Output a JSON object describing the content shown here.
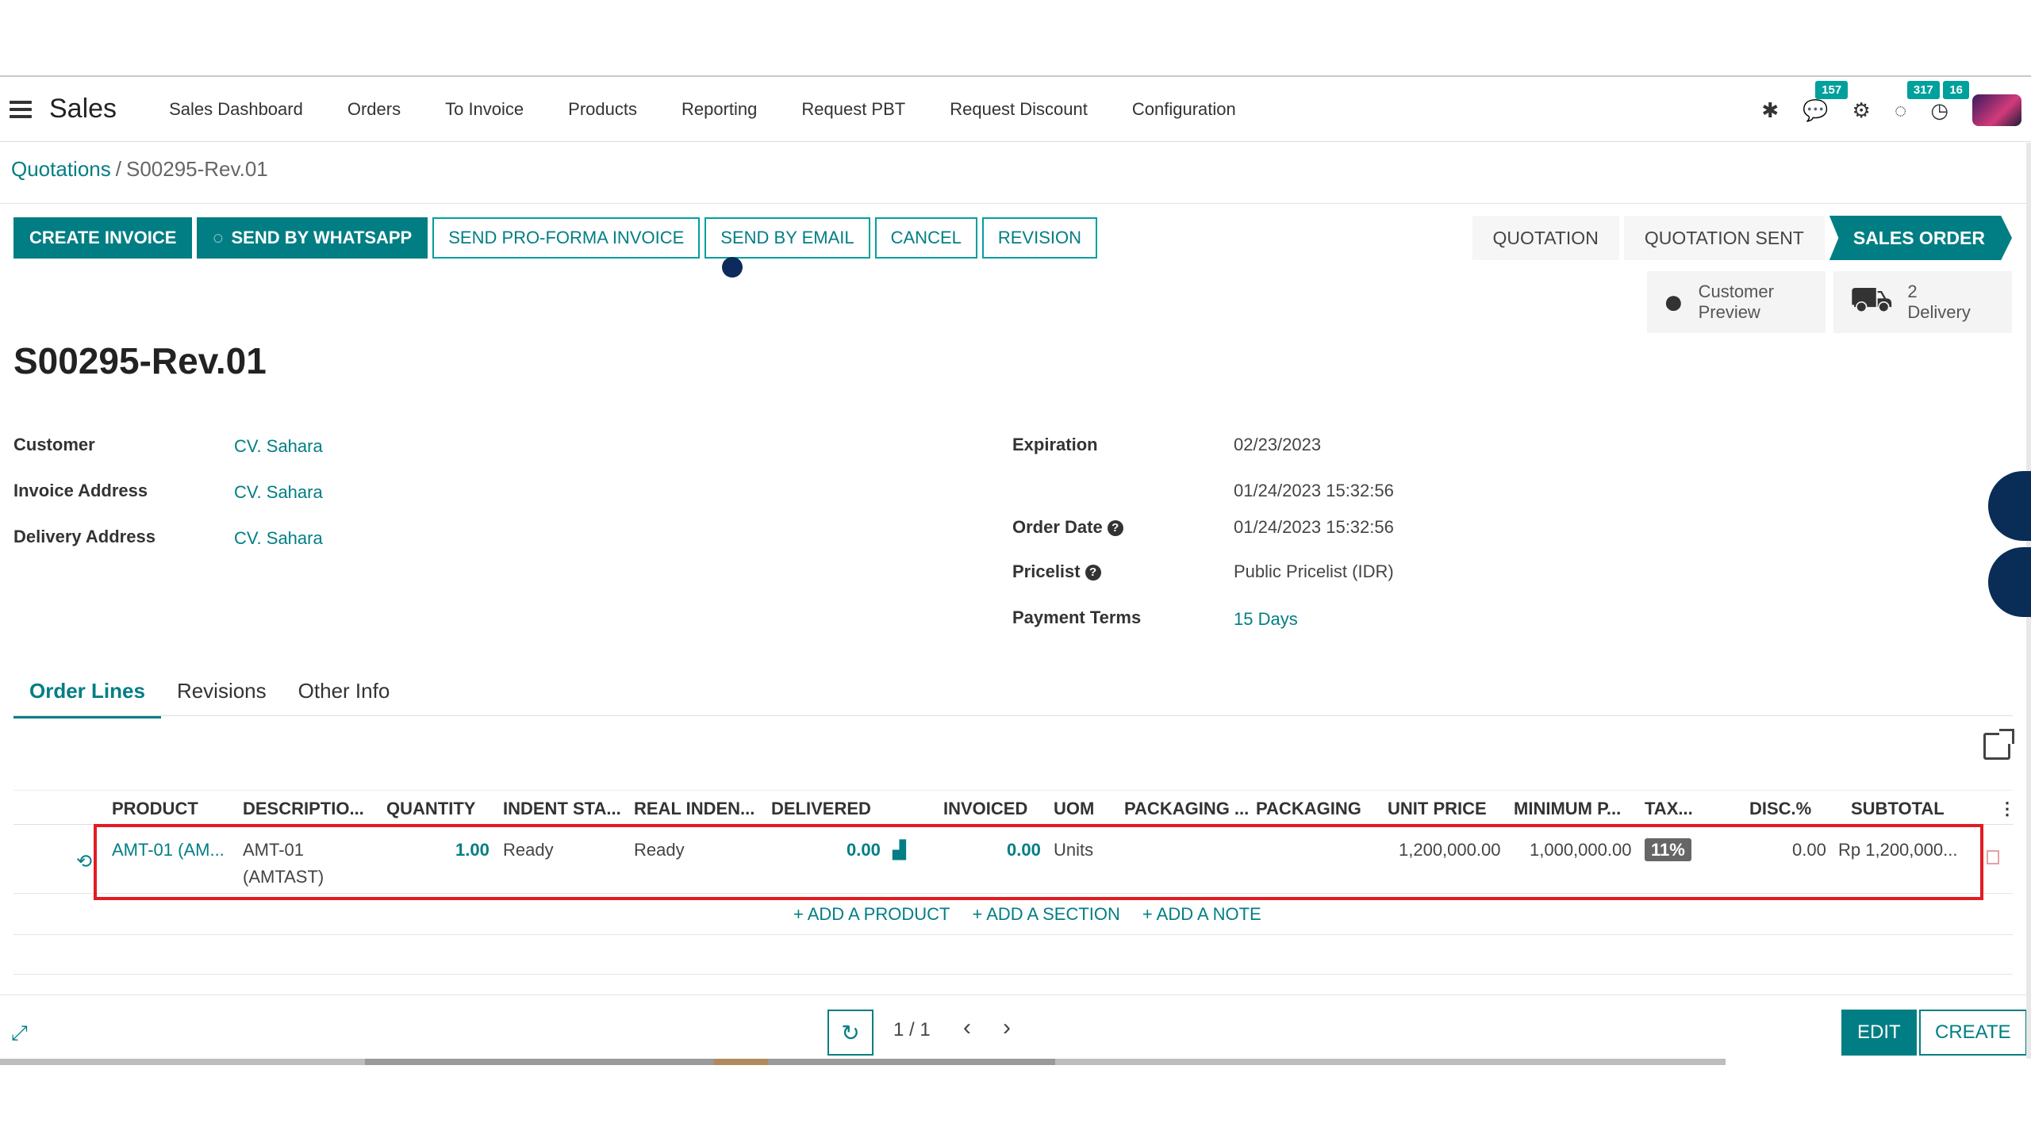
{
  "app": {
    "brand": "Sales"
  },
  "menu": [
    "Sales Dashboard",
    "Orders",
    "To Invoice",
    "Products",
    "Reporting",
    "Request PBT",
    "Request Discount",
    "Configuration"
  ],
  "systray": {
    "messages_badge": "157",
    "activity_badge": "317",
    "clock_badge": "16"
  },
  "breadcrumb": {
    "parent": "Quotations",
    "separator": "/",
    "current": "S00295-Rev.01"
  },
  "actions": {
    "create_invoice": "CREATE INVOICE",
    "send_whatsapp": "SEND BY WHATSAPP",
    "send_proforma": "SEND PRO-FORMA INVOICE",
    "send_email": "SEND BY EMAIL",
    "cancel": "CANCEL",
    "revision": "REVISION"
  },
  "status": {
    "quotation": "QUOTATION",
    "quotation_sent": "QUOTATION SENT",
    "sales_order": "SALES ORDER"
  },
  "smart": {
    "preview_line1": "Customer",
    "preview_line2": "Preview",
    "delivery_count": "2",
    "delivery_label": "Delivery"
  },
  "title": "S00295-Rev.01",
  "fields": {
    "customer_label": "Customer",
    "customer": "CV. Sahara",
    "invoice_label": "Invoice Address",
    "invoice": "CV. Sahara",
    "delivery_label": "Delivery Address",
    "delivery": "CV. Sahara",
    "expiration_label": "Expiration",
    "expiration": "02/23/2023",
    "extra_date": "01/24/2023 15:32:56",
    "order_date_label": "Order Date",
    "order_date": "01/24/2023 15:32:56",
    "pricelist_label": "Pricelist",
    "pricelist": "Public Pricelist (IDR)",
    "payment_label": "Payment Terms",
    "payment": "15 Days",
    "help_glyph": "?"
  },
  "tabs": [
    "Order Lines",
    "Revisions",
    "Other Info"
  ],
  "table": {
    "headers": [
      "PRODUCT",
      "DESCRIPTIO...",
      "QUANTITY",
      "INDENT STA...",
      "REAL INDEN...",
      "DELIVERED",
      "INVOICED",
      "UOM",
      "PACKAGING ...",
      "PACKAGING",
      "UNIT PRICE",
      "MINIMUM P...",
      "TAX...",
      "DISC.%",
      "SUBTOTAL"
    ],
    "row": {
      "product": "AMT-01 (AM...",
      "description_line1": "AMT-01",
      "description_line2": "(AMTAST)",
      "quantity": "1.00",
      "indent_status": "Ready",
      "real_indent": "Ready",
      "delivered": "0.00",
      "invoiced": "0.00",
      "uom": "Units",
      "unit_price": "1,200,000.00",
      "minimum_price": "1,000,000.00",
      "tax": "11%",
      "discount": "0.00",
      "subtotal": "Rp 1,200,000..."
    }
  },
  "add": {
    "product": "+ ADD A PRODUCT",
    "section": "+ ADD A SECTION",
    "note": "+ ADD A NOTE"
  },
  "pager": {
    "value": "1 / 1"
  },
  "footer": {
    "edit": "EDIT",
    "create": "CREATE"
  },
  "colors": {
    "primary": "#017e84",
    "highlight": "#e31b23"
  }
}
